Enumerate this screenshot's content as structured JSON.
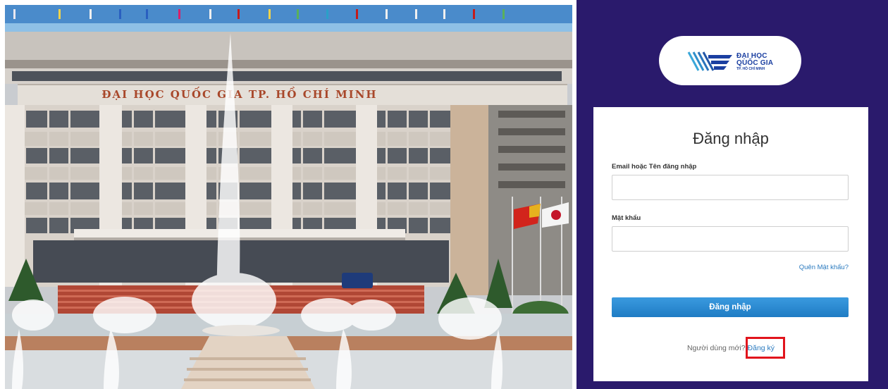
{
  "photo": {
    "sign_text": "ĐẠI HỌC QUỐC GIA TP. HỒ CHÍ MINH"
  },
  "logo": {
    "icon": "vnu-hcm-logo-mark",
    "line1": "ĐẠI HỌC",
    "line2": "QUỐC GIA",
    "line3": "TP. HỒ CHÍ MINH"
  },
  "login": {
    "title": "Đăng nhập",
    "username_label": "Email hoặc Tên đăng nhập",
    "username_value": "",
    "password_label": "Mật khẩu",
    "password_value": "",
    "forgot_label": "Quên Mật khẩu?",
    "submit_label": "Đăng nhập",
    "new_user_text": "Người dùng mới?",
    "signup_label": "Đăng ký"
  },
  "colors": {
    "panel_bg": "#2a1a6c",
    "button": "#1f7cc4",
    "link": "#2a7abf",
    "highlight": "#e1141c"
  }
}
